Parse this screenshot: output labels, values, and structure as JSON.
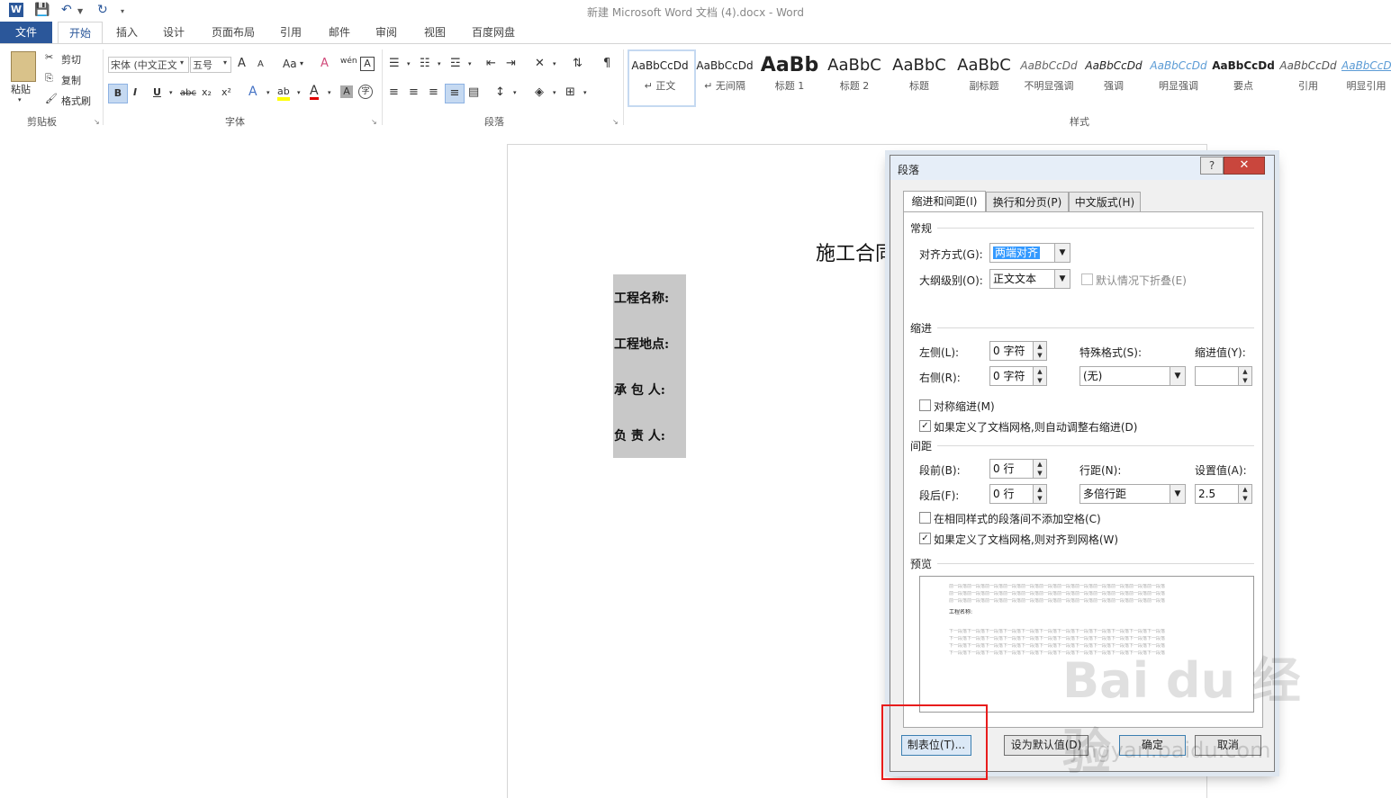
{
  "window": {
    "title": "新建 Microsoft Word 文档 (4).docx - Word"
  },
  "quick_access": [
    "word-logo-icon",
    "save-icon",
    "undo-icon",
    "redo-icon",
    "customize-icon"
  ],
  "tabs": [
    {
      "label": "文件"
    },
    {
      "label": "开始"
    },
    {
      "label": "插入"
    },
    {
      "label": "设计"
    },
    {
      "label": "页面布局"
    },
    {
      "label": "引用"
    },
    {
      "label": "邮件"
    },
    {
      "label": "审阅"
    },
    {
      "label": "视图"
    },
    {
      "label": "百度网盘"
    }
  ],
  "clipboard": {
    "paste": "粘贴",
    "cut": "剪切",
    "copy": "复制",
    "format_painter": "格式刷",
    "group": "剪贴板"
  },
  "font": {
    "name": "宋体 (中文正文",
    "size": "五号",
    "case_btn": "Aa",
    "bold": "B",
    "italic": "I",
    "underline": "U",
    "strike": "abc",
    "sub": "x₂",
    "sup": "x²",
    "group": "字体",
    "grow": "A",
    "shrink": "A",
    "clear": "A",
    "wen": "wén",
    "box": "A",
    "color": "A",
    "highlight": "ab",
    "shade": "A",
    "circle": "字"
  },
  "paragraph": {
    "group": "段落"
  },
  "styles": {
    "group": "样式",
    "items": [
      {
        "sample": "AaBbCcDd",
        "name": "↵ 正文"
      },
      {
        "sample": "AaBbCcDd",
        "name": "↵ 无间隔"
      },
      {
        "sample": "AaBb",
        "name": "标题 1"
      },
      {
        "sample": "AaBbC",
        "name": "标题 2"
      },
      {
        "sample": "AaBbC",
        "name": "标题"
      },
      {
        "sample": "AaBbC",
        "name": "副标题"
      },
      {
        "sample": "AaBbCcDd",
        "name": "不明显强调"
      },
      {
        "sample": "AaBbCcDd",
        "name": "强调"
      },
      {
        "sample": "AaBbCcDd",
        "name": "明显强调"
      },
      {
        "sample": "AaBbCcDd",
        "name": "要点"
      },
      {
        "sample": "AaBbCcDd",
        "name": "引用"
      },
      {
        "sample": "AaBbCcD",
        "name": "明显引用"
      }
    ]
  },
  "document": {
    "title": "施工合同",
    "lines": [
      "工程名称:",
      "工程地点:",
      "承 包 人:",
      "负 责 人:"
    ]
  },
  "dialog": {
    "title": "段落",
    "help": "?",
    "close": "✕",
    "tabs": [
      "缩进和间距(I)",
      "换行和分页(P)",
      "中文版式(H)"
    ],
    "general": {
      "section": "常规",
      "alignment_label": "对齐方式(G):",
      "alignment_value": "两端对齐",
      "outline_label": "大纲级别(O):",
      "outline_value": "正文文本",
      "collapse_label": "默认情况下折叠(E)"
    },
    "indent": {
      "section": "缩进",
      "left_label": "左侧(L):",
      "left_value": "0 字符",
      "right_label": "右侧(R):",
      "right_value": "0 字符",
      "special_label": "特殊格式(S):",
      "special_value": "(无)",
      "by_label": "缩进值(Y):",
      "by_value": "",
      "mirror_label": "对称缩进(M)",
      "mirror_checked": false,
      "auto_label": "如果定义了文档网格,则自动调整右缩进(D)",
      "auto_checked": true
    },
    "spacing": {
      "section": "间距",
      "before_label": "段前(B):",
      "before_value": "0 行",
      "after_label": "段后(F):",
      "after_value": "0 行",
      "line_label": "行距(N):",
      "line_value": "多倍行距",
      "at_label": "设置值(A):",
      "at_value": "2.5",
      "nospace_label": "在相同样式的段落间不添加空格(C)",
      "nospace_checked": false,
      "grid_label": "如果定义了文档网格,则对齐到网格(W)",
      "grid_checked": true
    },
    "preview": {
      "section": "预览",
      "prev_text": "前一段落前一段落前一段落前一段落前一段落前一段落前一段落前一段落前一段落前一段落前一段落前一段落",
      "cur_text": "工程名称:",
      "next_text": "下一段落下一段落下一段落下一段落下一段落下一段落下一段落下一段落下一段落下一段落下一段落下一段落"
    },
    "buttons": {
      "tabs": "制表位(T)...",
      "default": "设为默认值(D)",
      "ok": "确定",
      "cancel": "取消"
    }
  },
  "watermark": {
    "text": "Bai du 经验",
    "sub": "jingyan.baidu.com"
  },
  "colors": {
    "accent": "#2b579a",
    "highlight": "#e81c1c"
  }
}
